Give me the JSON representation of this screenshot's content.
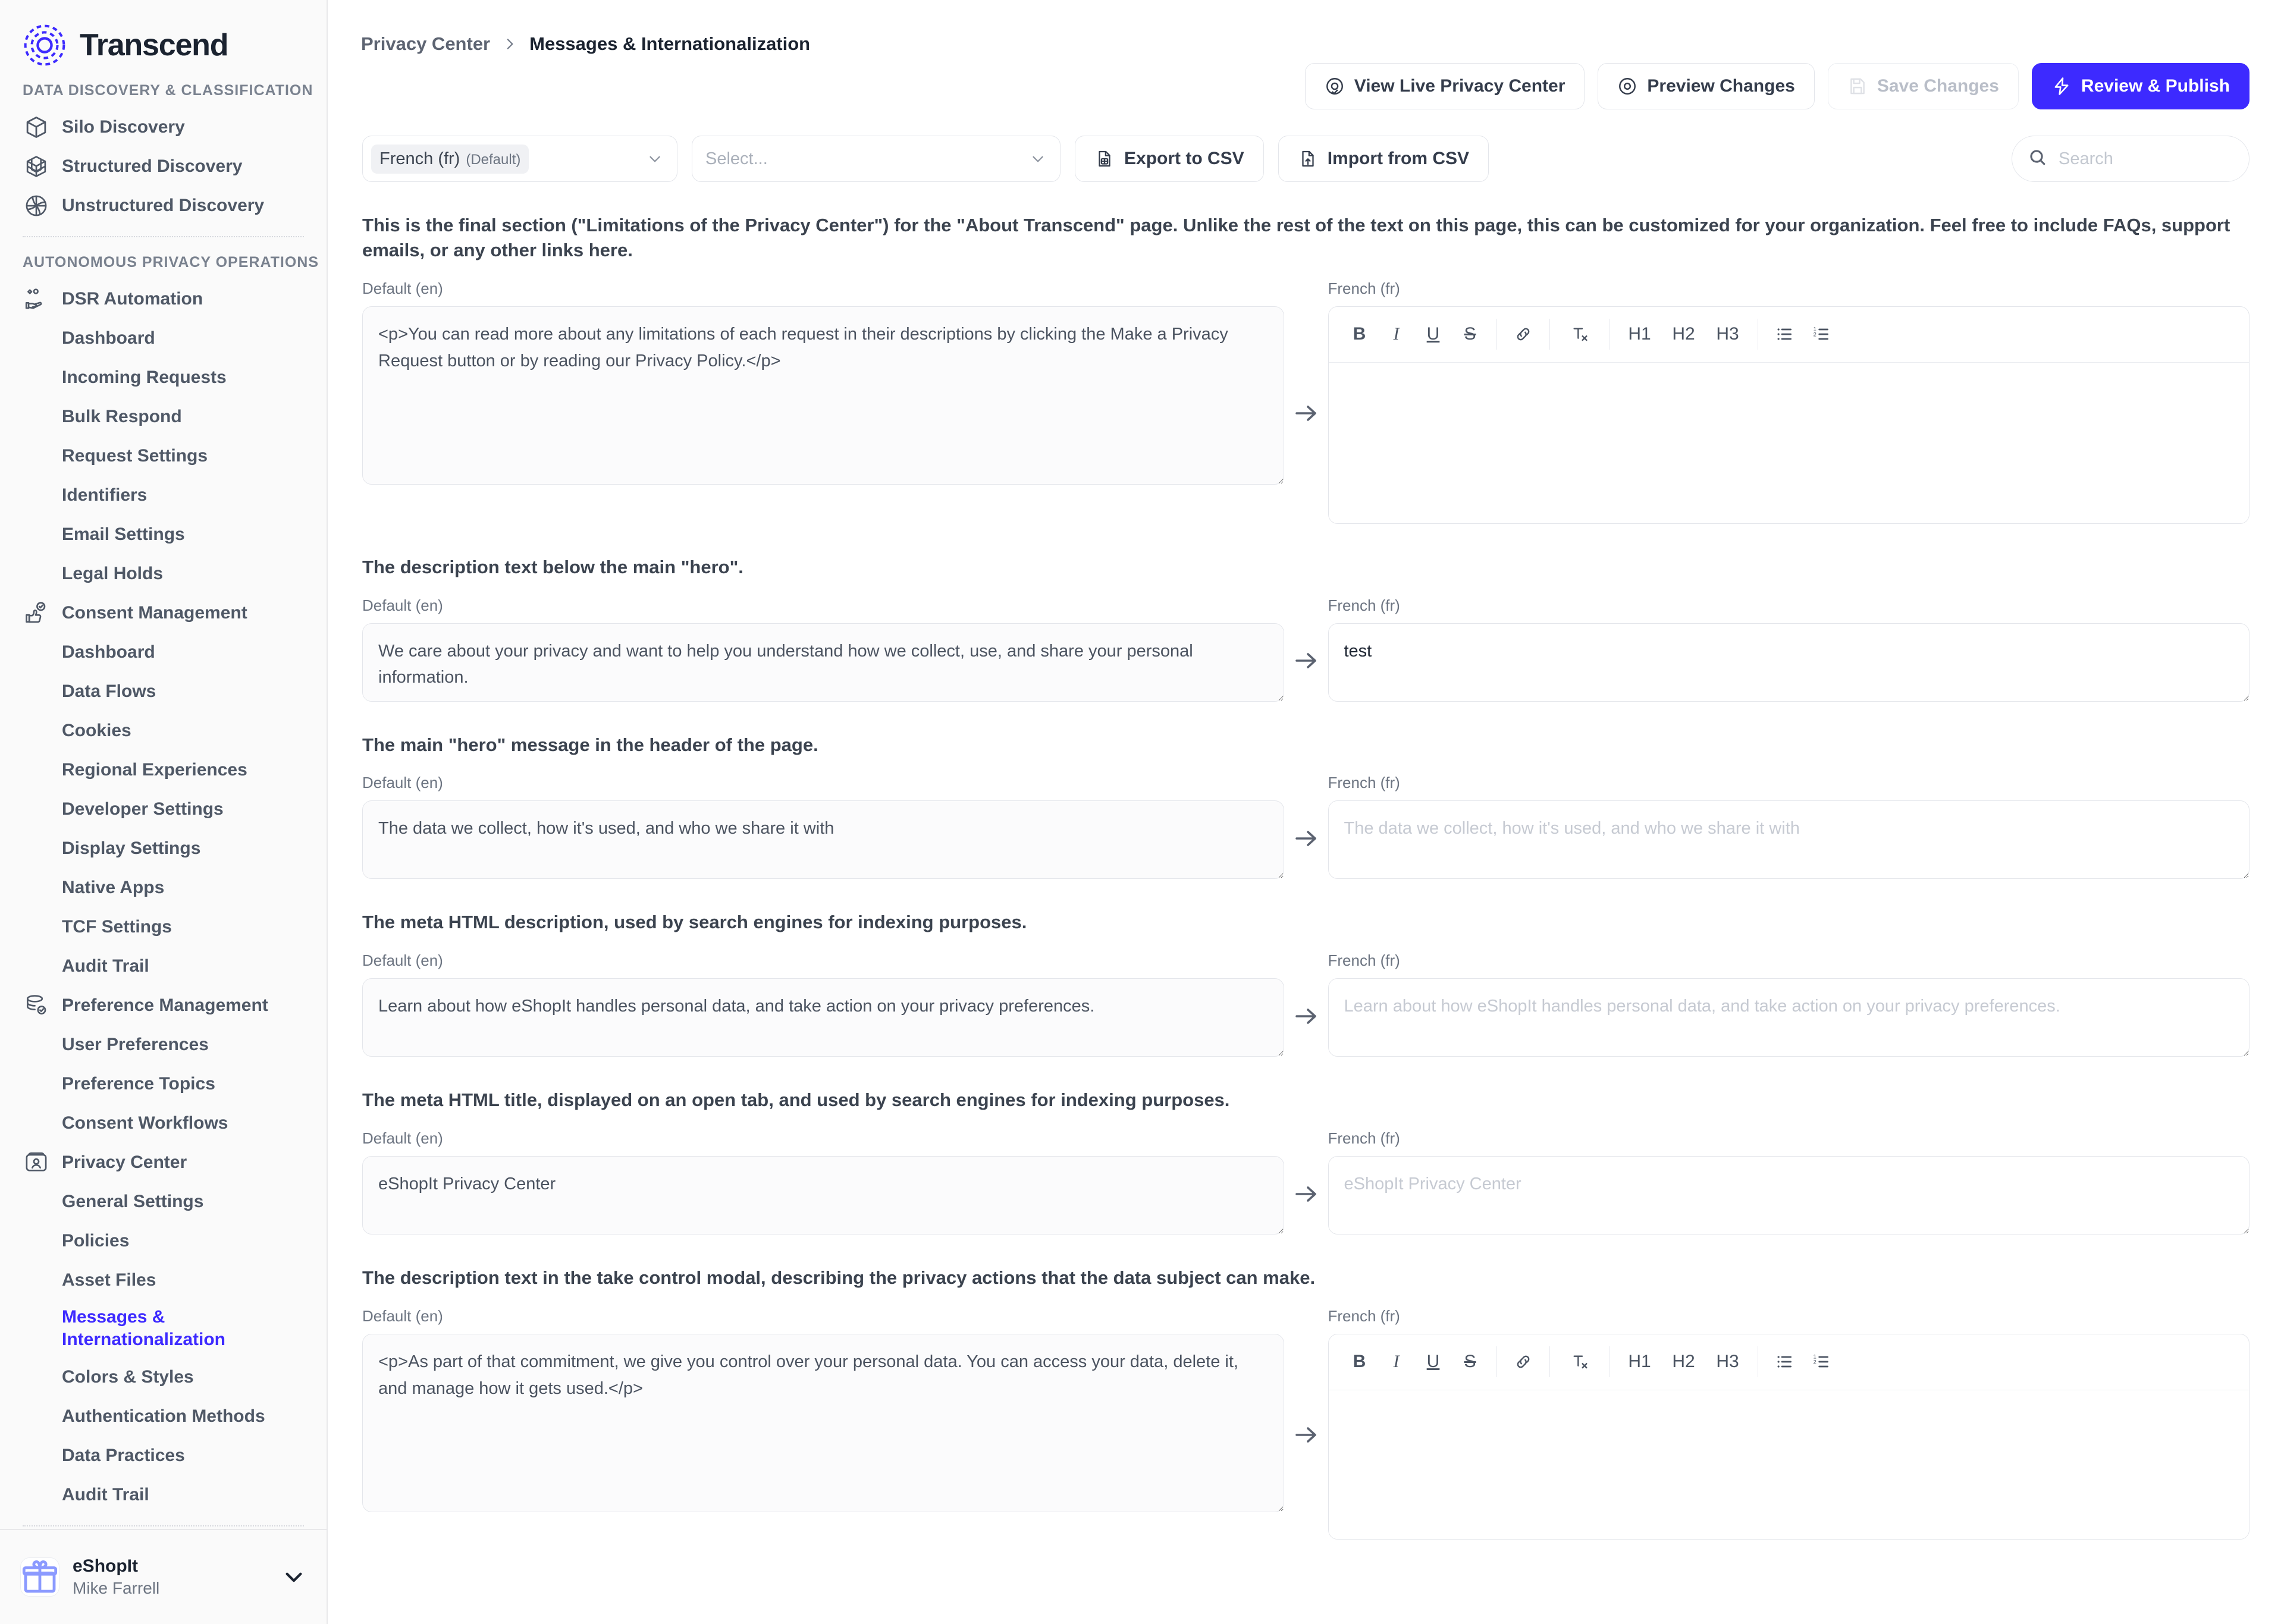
{
  "brand": {
    "name": "Transcend",
    "logo_icon": "transcend-logo-icon"
  },
  "sidebar": {
    "groups": [
      {
        "title": "DATA DISCOVERY & CLASSIFICATION",
        "items": [
          {
            "label": "Silo Discovery",
            "icon": "cube-icon",
            "level": "top",
            "active": false
          },
          {
            "label": "Structured Discovery",
            "icon": "grid-cube-icon",
            "level": "top",
            "active": false
          },
          {
            "label": "Unstructured Discovery",
            "icon": "globe-icon",
            "level": "top",
            "active": false
          }
        ]
      },
      {
        "title": "AUTONOMOUS PRIVACY OPERATIONS",
        "items": [
          {
            "label": "DSR Automation",
            "icon": "hand-data-icon",
            "level": "top",
            "active": false
          },
          {
            "label": "Dashboard",
            "icon": "",
            "level": "sub",
            "active": false
          },
          {
            "label": "Incoming Requests",
            "icon": "",
            "level": "sub",
            "active": false
          },
          {
            "label": "Bulk Respond",
            "icon": "",
            "level": "sub",
            "active": false
          },
          {
            "label": "Request Settings",
            "icon": "",
            "level": "sub",
            "active": false
          },
          {
            "label": "Identifiers",
            "icon": "",
            "level": "sub",
            "active": false
          },
          {
            "label": "Email Settings",
            "icon": "",
            "level": "sub",
            "active": false
          },
          {
            "label": "Legal Holds",
            "icon": "",
            "level": "sub",
            "active": false
          },
          {
            "label": "Consent Management",
            "icon": "thumb-check-icon",
            "level": "top",
            "active": false
          },
          {
            "label": "Dashboard",
            "icon": "",
            "level": "sub",
            "active": false
          },
          {
            "label": "Data Flows",
            "icon": "",
            "level": "sub",
            "active": false
          },
          {
            "label": "Cookies",
            "icon": "",
            "level": "sub",
            "active": false
          },
          {
            "label": "Regional Experiences",
            "icon": "",
            "level": "sub",
            "active": false
          },
          {
            "label": "Developer Settings",
            "icon": "",
            "level": "sub",
            "active": false
          },
          {
            "label": "Display Settings",
            "icon": "",
            "level": "sub",
            "active": false
          },
          {
            "label": "Native Apps",
            "icon": "",
            "level": "sub",
            "active": false
          },
          {
            "label": "TCF Settings",
            "icon": "",
            "level": "sub",
            "active": false
          },
          {
            "label": "Audit Trail",
            "icon": "",
            "level": "sub",
            "active": false
          },
          {
            "label": "Preference Management",
            "icon": "database-check-icon",
            "level": "top",
            "active": false
          },
          {
            "label": "User Preferences",
            "icon": "",
            "level": "sub",
            "active": false
          },
          {
            "label": "Preference Topics",
            "icon": "",
            "level": "sub",
            "active": false
          },
          {
            "label": "Consent Workflows",
            "icon": "",
            "level": "sub",
            "active": false
          },
          {
            "label": "Privacy Center",
            "icon": "id-card-icon",
            "level": "top",
            "active": false
          },
          {
            "label": "General Settings",
            "icon": "",
            "level": "sub",
            "active": false
          },
          {
            "label": "Policies",
            "icon": "",
            "level": "sub",
            "active": false
          },
          {
            "label": "Asset Files",
            "icon": "",
            "level": "sub",
            "active": false
          },
          {
            "label": "Messages & Internationalization",
            "icon": "",
            "level": "sub",
            "active": true
          },
          {
            "label": "Colors & Styles",
            "icon": "",
            "level": "sub",
            "active": false
          },
          {
            "label": "Authentication Methods",
            "icon": "",
            "level": "sub",
            "active": false
          },
          {
            "label": "Data Practices",
            "icon": "",
            "level": "sub",
            "active": false
          },
          {
            "label": "Audit Trail",
            "icon": "",
            "level": "sub",
            "active": false
          }
        ]
      }
    ],
    "footer": {
      "org_name": "eShopIt",
      "user_name": "Mike Farrell",
      "avatar_icon": "gift-icon",
      "chevron_icon": "chevron-down-icon"
    }
  },
  "breadcrumb": {
    "parent": "Privacy Center",
    "separator_icon": "chevron-right-icon",
    "current": "Messages & Internationalization"
  },
  "actions": {
    "view_live": {
      "label": "View Live Privacy Center",
      "icon": "target-check-icon"
    },
    "preview": {
      "label": "Preview Changes",
      "icon": "circle-dot-icon"
    },
    "save": {
      "label": "Save Changes",
      "icon": "floppy-disk-icon",
      "disabled": true
    },
    "review": {
      "label": "Review & Publish",
      "icon": "lightning-icon",
      "color": "#3d2aff"
    }
  },
  "toolbar": {
    "language_select": {
      "value": "French (fr)",
      "tag": "(Default)",
      "caret_icon": "chevron-down-icon"
    },
    "message_select": {
      "placeholder": "Select...",
      "caret_icon": "chevron-down-icon"
    },
    "export_csv": {
      "label": "Export to CSV",
      "icon": "export-csv-icon"
    },
    "import_csv": {
      "label": "Import from CSV",
      "icon": "import-csv-icon"
    },
    "search": {
      "placeholder": "Search",
      "value": "",
      "icon": "search-icon"
    }
  },
  "labels": {
    "default_en": "Default (en)",
    "french_fr": "French (fr)",
    "arrow_icon": "arrow-right-icon"
  },
  "rte_toolbar": {
    "bold": "B",
    "italic": "I",
    "underline": "U",
    "strike": "S",
    "link_icon": "link-icon",
    "clear_format_icon": "clear-format-icon",
    "h1": "H1",
    "h2": "H2",
    "h3": "H3",
    "bullet_list_icon": "bullet-list-icon",
    "numbered_list_icon": "numbered-list-icon"
  },
  "messages": [
    {
      "description": "This is the final section (\"Limitations of the Privacy Center\") for the \"About Transcend\" page. Unlike the rest of the text on this page, this can be customized for your organization. Feel free to include FAQs, support emails, or any other links here.",
      "default_value": "<p>You can read more about any limitations of each request in their descriptions by clicking the Make a Privacy Request button or by reading our Privacy Policy.</p>",
      "default_placeholder": "",
      "translation_kind": "rich",
      "translation_value": "",
      "translation_placeholder": ""
    },
    {
      "description": "The description text below the main \"hero\".",
      "default_value": "We care about your privacy and want to help you understand how we collect, use, and share your personal information.",
      "default_placeholder": "",
      "translation_kind": "text",
      "translation_value": "test",
      "translation_placeholder": ""
    },
    {
      "description": "The main \"hero\" message in the header of the page.",
      "default_value": "The data we collect, how it's used, and who we share it with",
      "default_placeholder": "",
      "translation_kind": "text",
      "translation_value": "",
      "translation_placeholder": "The data we collect, how it's used, and who we share it with"
    },
    {
      "description": "The meta HTML description, used by search engines for indexing purposes.",
      "default_value": "Learn about how eShopIt handles personal data, and take action on your privacy preferences.",
      "default_placeholder": "",
      "translation_kind": "text",
      "translation_value": "",
      "translation_placeholder": "Learn about how eShopIt handles personal data, and take action on your privacy preferences."
    },
    {
      "description": "The meta HTML title, displayed on an open tab, and used by search engines for indexing purposes.",
      "default_value": "eShopIt Privacy Center",
      "default_placeholder": "",
      "translation_kind": "text",
      "translation_value": "",
      "translation_placeholder": "eShopIt Privacy Center"
    },
    {
      "description": "The description text in the take control modal, describing the privacy actions that the data subject can make.",
      "default_value": "<p>As part of that commitment, we give you control over your personal data. You can access your data, delete it, and manage how it gets used.</p>",
      "default_placeholder": "",
      "translation_kind": "rich",
      "translation_value": "",
      "translation_placeholder": ""
    }
  ]
}
